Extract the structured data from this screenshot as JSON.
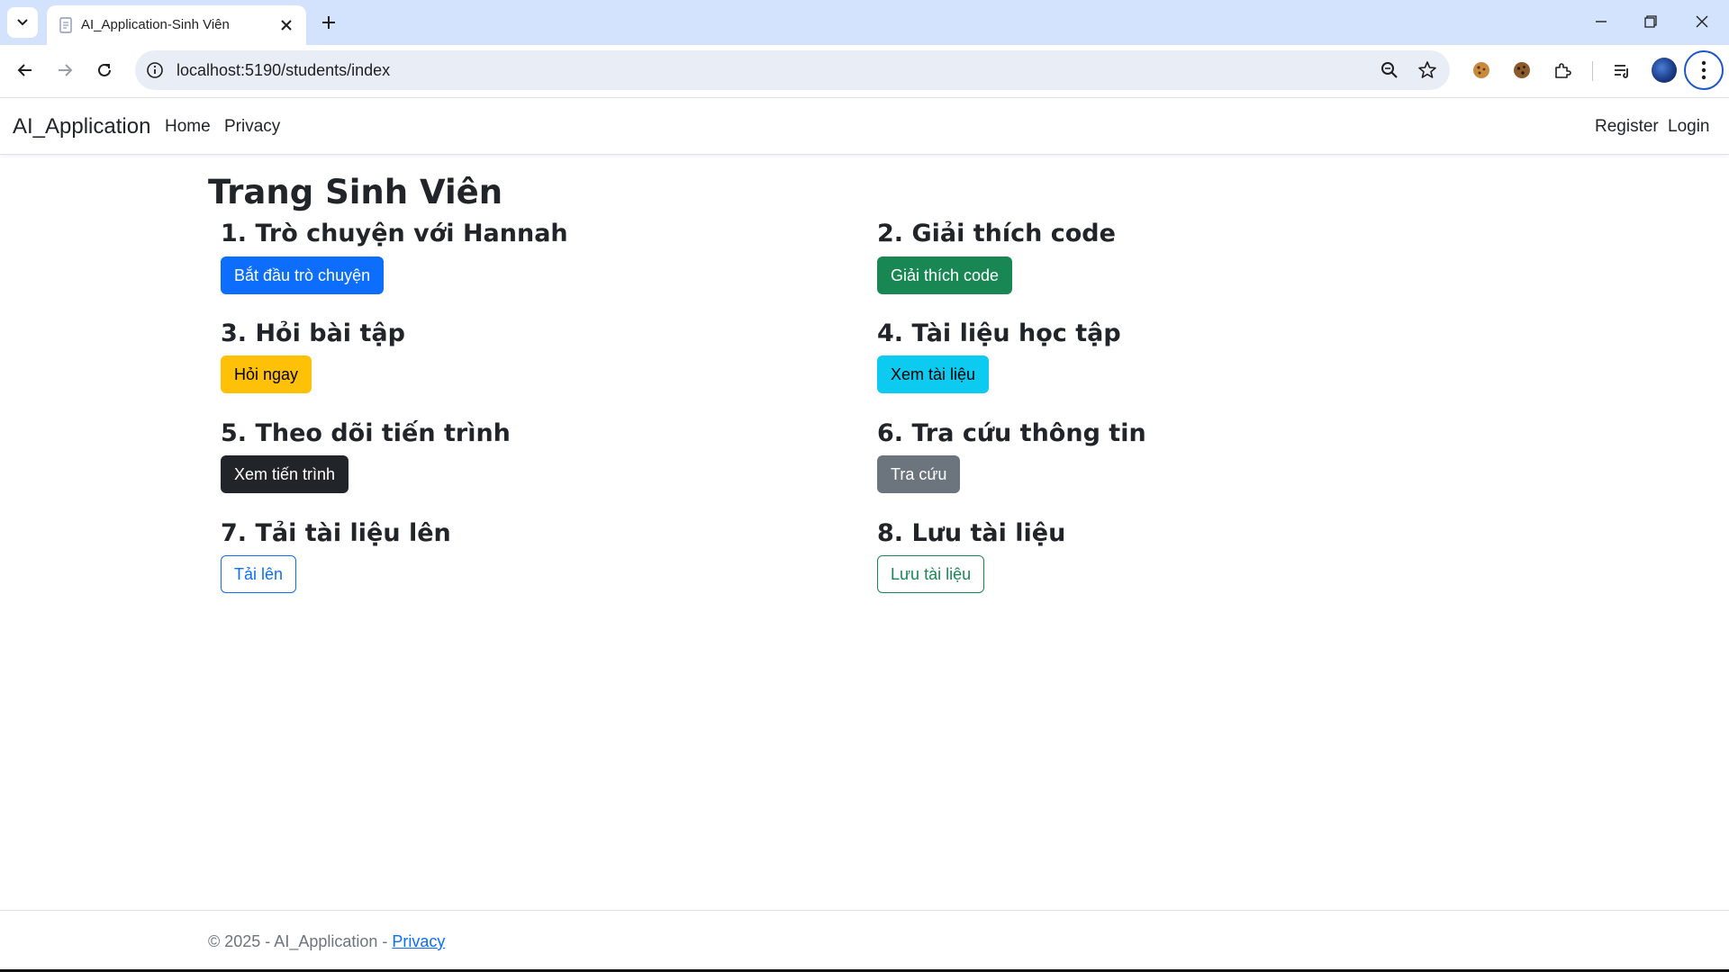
{
  "browser": {
    "tab_title": "AI_Application-Sinh Viên",
    "url": "localhost:5190/students/index"
  },
  "navbar": {
    "brand": "AI_Application",
    "links": [
      "Home",
      "Privacy"
    ],
    "right_links": [
      "Register",
      "Login"
    ]
  },
  "main": {
    "title": "Trang Sinh Viên",
    "cards": [
      {
        "heading": "1. Trò chuyện với Hannah",
        "button": "Bắt đầu trò chuyện",
        "style": "primary"
      },
      {
        "heading": "2. Giải thích code",
        "button": "Giải thích code",
        "style": "success"
      },
      {
        "heading": "3. Hỏi bài tập",
        "button": "Hỏi ngay",
        "style": "warning"
      },
      {
        "heading": "4. Tài liệu học tập",
        "button": "Xem tài liệu",
        "style": "info"
      },
      {
        "heading": "5. Theo dõi tiến trình",
        "button": "Xem tiến trình",
        "style": "dark"
      },
      {
        "heading": "6. Tra cứu thông tin",
        "button": "Tra cứu",
        "style": "secondary"
      },
      {
        "heading": "7. Tải tài liệu lên",
        "button": "Tải lên",
        "style": "outline-primary"
      },
      {
        "heading": "8. Lưu tài liệu",
        "button": "Lưu tài liệu",
        "style": "outline-success"
      }
    ]
  },
  "footer": {
    "text": "© 2025 - AI_Application - ",
    "link": "Privacy"
  },
  "icons": {
    "back": "arrow-left-icon",
    "forward": "arrow-right-icon",
    "reload": "reload-icon",
    "info": "site-info-icon",
    "zoom": "zoom-icon",
    "bookmark": "star-icon",
    "extensions": "puzzle-icon",
    "media": "media-queue-icon",
    "menu": "kebab-menu-icon"
  },
  "colors": {
    "primary": "#0d6efd",
    "success": "#198754",
    "warning": "#ffc107",
    "info": "#0dcaf0",
    "dark": "#212529",
    "secondary": "#6c757d",
    "chrome_tabbar": "#d3e3fd"
  }
}
